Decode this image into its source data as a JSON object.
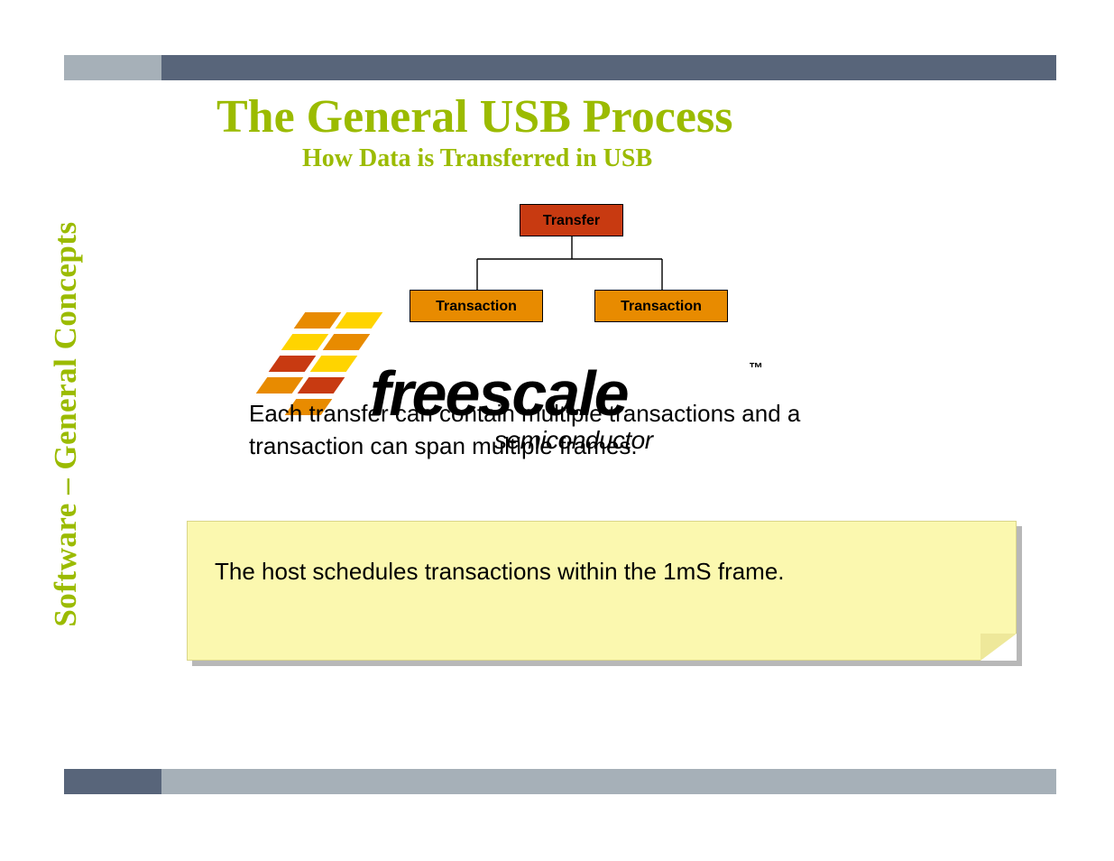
{
  "sidebar": {
    "label": "Software – General Concepts"
  },
  "heading": {
    "title": "The General USB Process",
    "subtitle": "How Data is Transferred in USB"
  },
  "diagram": {
    "transfer": "Transfer",
    "transaction1": "Transaction",
    "transaction2": "Transaction"
  },
  "logo": {
    "brand": "freescale",
    "tm": "™",
    "sub": "semiconductor"
  },
  "body": {
    "paragraph": "Each transfer can contain multiple transactions and a transaction can span multiple frames."
  },
  "note": {
    "text": "The host schedules transactions within the 1mS frame."
  },
  "colors": {
    "accent_green": "#9bbb00",
    "transfer_box": "#c83a11",
    "transaction_box": "#e88b00",
    "bar_grey": "#a6b0b8",
    "bar_dark": "#58657a",
    "sticky": "#fbf8af"
  }
}
